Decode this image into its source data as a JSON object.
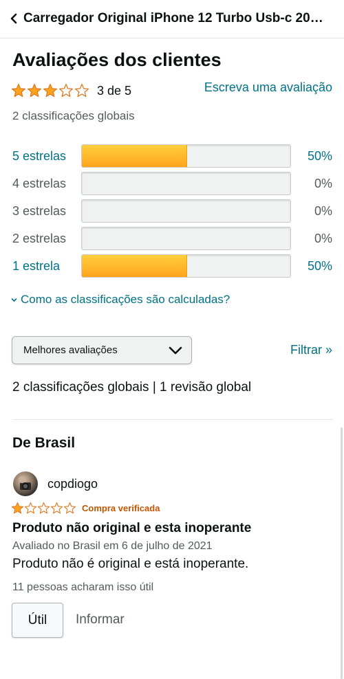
{
  "header": {
    "title": "Carregador Original iPhone 12 Turbo Usb-c 20w i..."
  },
  "reviews_section": {
    "title": "Avaliações dos clientes",
    "rating_stars": 3,
    "rating_max": 5,
    "average_text": "3 de 5",
    "write_review_link": "Escreva uma avaliação",
    "global_ratings_text": "2 classificações globais"
  },
  "histogram": [
    {
      "label": "5 estrelas",
      "percent_text": "50%",
      "percent": 50,
      "is_link": true
    },
    {
      "label": "4 estrelas",
      "percent_text": "0%",
      "percent": 0,
      "is_link": false
    },
    {
      "label": "3 estrelas",
      "percent_text": "0%",
      "percent": 0,
      "is_link": false
    },
    {
      "label": "2 estrelas",
      "percent_text": "0%",
      "percent": 0,
      "is_link": false
    },
    {
      "label": "1 estrela",
      "percent_text": "50%",
      "percent": 50,
      "is_link": true
    }
  ],
  "how_calculated_link": "Como as classificações são calculadas?",
  "sort": {
    "selected": "Melhores avaliações"
  },
  "filter_link": "Filtrar »",
  "summary_text": "2 classificações globais | 1 revisão global",
  "country_section": {
    "title": "De Brasil"
  },
  "review": {
    "reviewer_name": "copdiogo",
    "stars": 1,
    "verified_badge": "Compra verificada",
    "title": "Produto não original e esta inoperante",
    "meta": "Avaliado no Brasil em 6 de julho de 2021",
    "body": "Produto não é original e está inoperante.",
    "helpful_count": "11 pessoas acharam isso útil",
    "helpful_button": "Útil",
    "report_link": "Informar"
  },
  "colors": {
    "link": "#007185",
    "star_fill": "#ffa41c",
    "star_outline": "#de7921",
    "verified": "#c45500",
    "text_secondary": "#565959"
  }
}
